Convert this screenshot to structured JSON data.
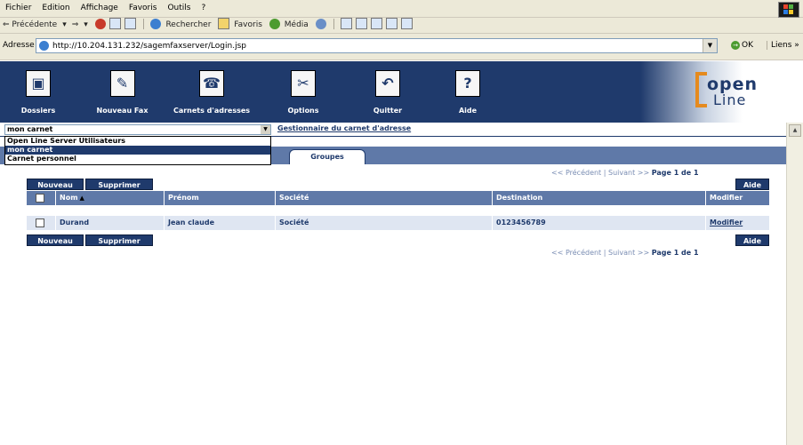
{
  "menu": [
    "Fichier",
    "Edition",
    "Affichage",
    "Favoris",
    "Outils",
    "?"
  ],
  "nav": {
    "back": "⇐ Précédente",
    "back_drop": "▾",
    "forward": "⇒",
    "forward_drop": "▾",
    "search": "Rechercher",
    "favorites": "Favoris",
    "media": "Média"
  },
  "address": {
    "label": "Adresse",
    "url": "http://10.204.131.232/sagemfaxserver/Login.jsp",
    "dropdown": "▼",
    "go": "OK",
    "go_glyph": "→",
    "links": "Liens »"
  },
  "header": {
    "buttons": [
      "Dossiers",
      "Nouveau Fax",
      "Carnets d'adresses",
      "Options",
      "Quitter",
      "Aide"
    ],
    "icon_glyphs": [
      "▣",
      "✎",
      "☎",
      "✂",
      "↶",
      "?"
    ],
    "logo_top": "open",
    "logo_bottom": "Line"
  },
  "carnet_select": {
    "value": "mon carnet",
    "arrow": "▼",
    "options": [
      "Open Line Server Utilisateurs",
      "mon carnet",
      "Carnet personnel"
    ],
    "selected_index": 1
  },
  "manager_link": "Gestionnaire du carnet d'adresse",
  "tab": "Groupes",
  "pager": {
    "prev": "<< Précédent",
    "sep": "|",
    "next": "Suivant >>",
    "page": "Page 1 de 1"
  },
  "buttons": {
    "new": "Nouveau",
    "delete": "Supprimer",
    "help": "Aide"
  },
  "table": {
    "columns": [
      "Nom",
      "Prénom",
      "Société",
      "Destination",
      "Modifier"
    ],
    "sort_indicator": "▲",
    "rows": [
      {
        "nom": "Durand",
        "prenom": "Jean claude",
        "societe": "Société",
        "destination": "0123456789",
        "modifier": "Modifier"
      }
    ]
  },
  "scroll_up": "▲",
  "colors": {
    "brand": "#1f3a6c",
    "band": "#5f79a8",
    "row_bg": "#dfe6f2",
    "logo_accent": "#e58a1e"
  }
}
